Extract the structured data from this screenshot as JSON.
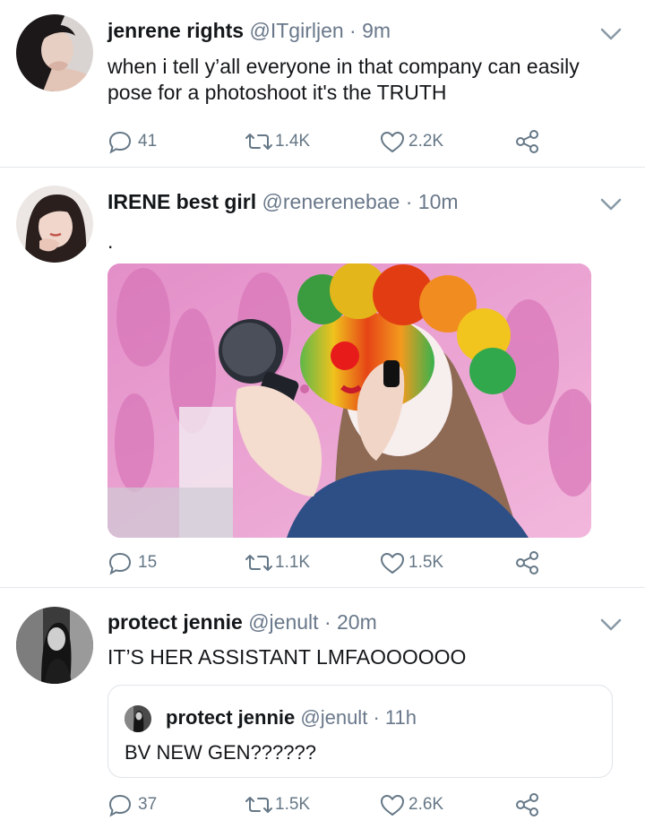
{
  "tweets": [
    {
      "name": "jenrene rights",
      "handle": "@ITgirljen",
      "separator": "·",
      "time": "9m",
      "text": "when i tell y’all everyone in that company can easily pose for a photoshoot it's the TRUTH",
      "replies": "41",
      "retweets": "1.4K",
      "likes": "2.2K"
    },
    {
      "name": "IRENE best girl",
      "handle": "@renerenebae",
      "separator": "·",
      "time": "10m",
      "text": ".",
      "replies": "15",
      "retweets": "1.1K",
      "likes": "1.5K"
    },
    {
      "name": "protect jennie",
      "handle": "@jenult",
      "separator": "·",
      "time": "20m",
      "text": "IT’S HER ASSISTANT LMFAOOOOOO",
      "replies": "37",
      "retweets": "1.5K",
      "likes": "2.6K",
      "quote": {
        "name": "protect jennie",
        "handle": "@jenult",
        "separator": "·",
        "time": "11h",
        "text": "BV NEW GEN??????"
      }
    }
  ],
  "colors": {
    "text_primary": "#14171a",
    "text_secondary": "#69788a",
    "divider": "#e3e7eb",
    "icon": "#657786"
  },
  "icons": [
    "reply-icon",
    "retweet-icon",
    "like-icon",
    "share-icon",
    "chevron-down-icon"
  ]
}
